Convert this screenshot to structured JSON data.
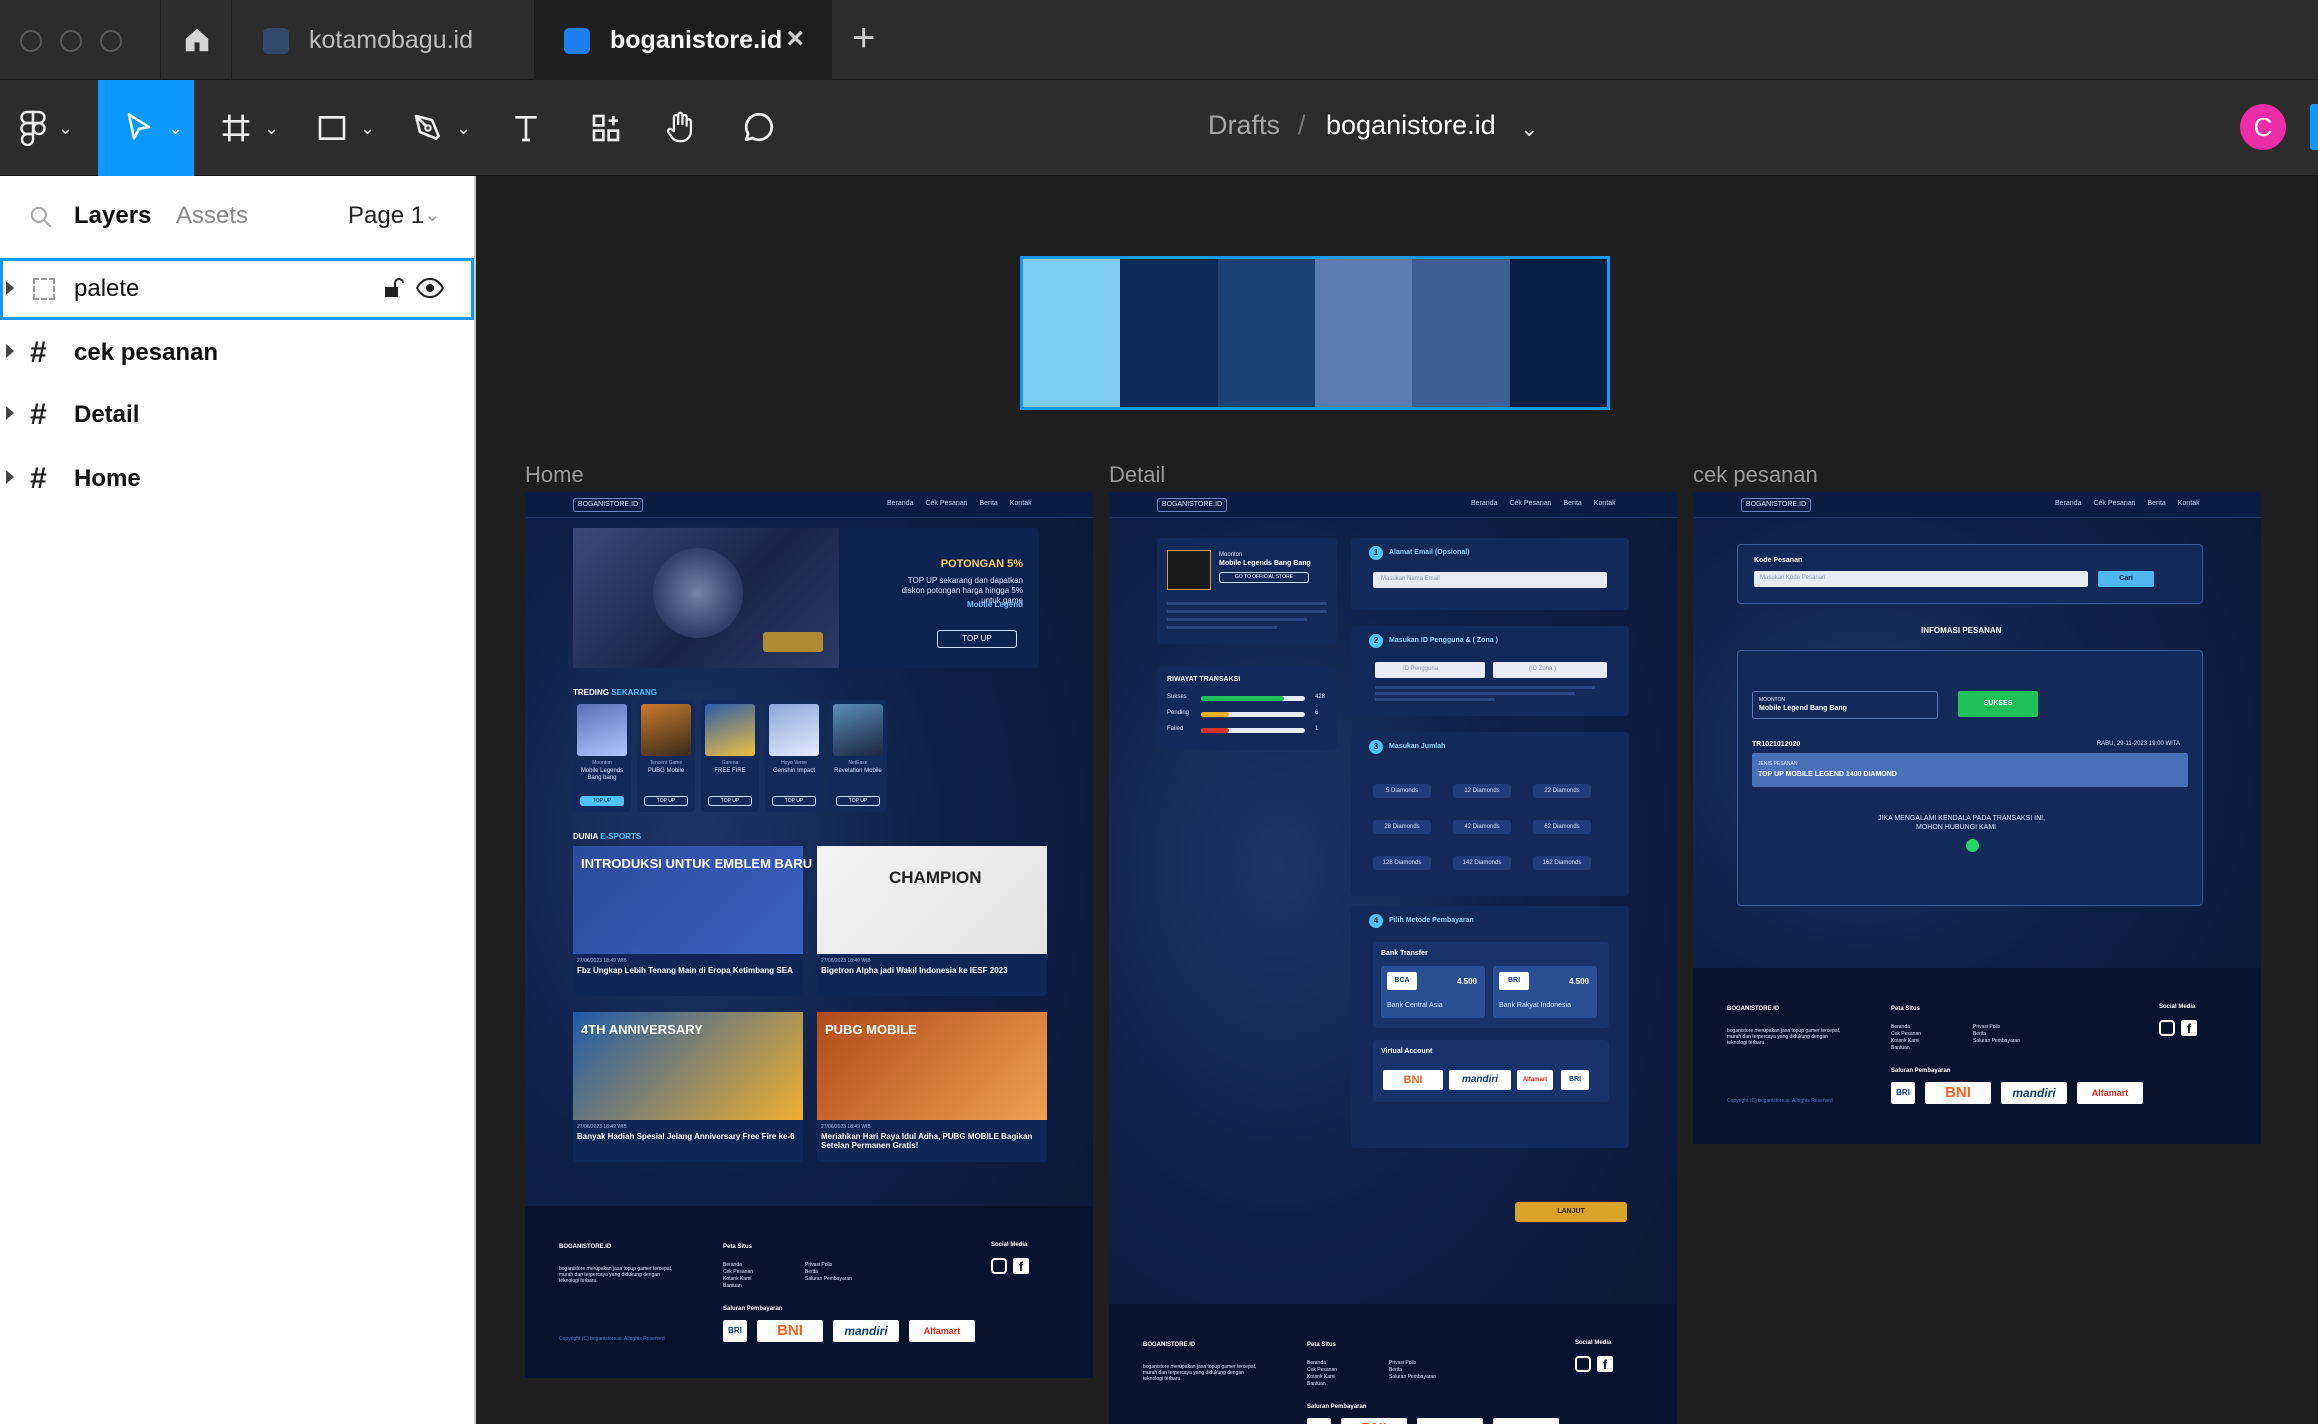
{
  "tabs": [
    {
      "label": "kotamobagu.id",
      "active": false
    },
    {
      "label": "boganistore.id",
      "active": true
    }
  ],
  "tab_close": "×",
  "new_tab": "+",
  "breadcrumb": {
    "project": "Drafts",
    "separator": "/",
    "file": "boganistore.id"
  },
  "user_initial": "C",
  "panel": {
    "tabs": [
      "Layers",
      "Assets"
    ],
    "page": "Page 1",
    "layers": [
      {
        "name": "palete",
        "type": "section",
        "selected": true
      },
      {
        "name": "cek pesanan",
        "type": "frame"
      },
      {
        "name": "Detail",
        "type": "frame"
      },
      {
        "name": "Home",
        "type": "frame"
      }
    ]
  },
  "palette": [
    "#7fcdf1",
    "#0c2a57",
    "#1d4275",
    "#5b7cb1",
    "#3d5f94",
    "#0a1f44"
  ],
  "colors": {
    "accent": "#0d99ff",
    "avatar": "#ed2ca8"
  },
  "frames": {
    "home": {
      "label": "Home",
      "logo": "BOGANISTORE.ID",
      "nav": [
        "Beranda",
        "Cek Pesanan",
        "Berita",
        "Kontak"
      ],
      "promo_title": "POTONGAN 5%",
      "promo_text": "TOP UP sekarang dan dapatkan diskon potongan harga hingga 5% untuk game",
      "promo_game": "Mobile Legend",
      "promo_button": "TOP UP",
      "trending_title": "TREDING",
      "trending_highlight": "SEKARANG",
      "games": [
        {
          "publisher": "Moonton",
          "name": "Mobile Legends Bang bang",
          "button": "TOP UP"
        },
        {
          "publisher": "Tencent Game",
          "name": "PUBG Mobile",
          "button": "TOP UP"
        },
        {
          "publisher": "Garena",
          "name": "FREE FIRE",
          "button": "TOP UP"
        },
        {
          "publisher": "Hoyo Verse",
          "name": "Genshin Impact",
          "button": "TOP UP"
        },
        {
          "publisher": "NetEase",
          "name": "Revelation Mobile",
          "button": "TOP UP"
        }
      ],
      "esports_title": "DUNIA",
      "esports_highlight": "E-SPORTS",
      "news": [
        {
          "banner": "INTRODUKSI UNTUK EMBLEM BARU",
          "date": "27/06/2023 18:49 WIB",
          "title": "Fbz Ungkap Lebih Tenang Main di Eropa Ketimbang SEA"
        },
        {
          "banner": "CHAMPION",
          "date": "27/06/2023 18:49 WIB",
          "title": "Bigetron Alpha jadi Wakil Indonesia ke IESF 2023"
        },
        {
          "banner": "4TH ANNIVERSARY",
          "date": "27/06/2023 18:49 WIB",
          "title": "Banyak Hadiah Spesial Jelang Anniversary Free Fire ke-6"
        },
        {
          "banner": "PUBG MOBILE",
          "date": "27/06/2023 18:49 WIB",
          "title": "Meriahkan Hari Raya Idul Adha, PUBG MOBILE Bagikan Setelan Permanen Gratis!"
        }
      ]
    },
    "detail": {
      "label": "Detail",
      "game_publisher": "Moonton",
      "game_name": "Mobile Legends Bang Bang",
      "official_badge": "GO TO OFFICIAL STORE",
      "history_title": "RIWAYAT TRANSAKSI",
      "history": [
        {
          "label": "Sukses",
          "value": 428
        },
        {
          "label": "Pending",
          "value": 6
        },
        {
          "label": "Failed",
          "value": 1
        }
      ],
      "step1": {
        "num": "1",
        "title": "Alamat Email (Opsional)",
        "placeholder": "Masukan Nama Email"
      },
      "step2": {
        "num": "2",
        "title": "Masukan ID Pengguna & ( Zona )",
        "id_placeholder": "ID Pengguna",
        "zone_placeholder": "(ID Zona )"
      },
      "step3": {
        "num": "3",
        "title": "Masukan Jumlah",
        "options": [
          "5 Diamonds",
          "12 Diamonds",
          "22 Diamonds",
          "28 Diamonds",
          "42 Diamonds",
          "62 Diamonds",
          "128 Diamonds",
          "142 Diamonds",
          "162 Diamonds"
        ]
      },
      "step4": {
        "num": "4",
        "title": "Pilih Metode Pembayaran",
        "bank_title": "Bank Transfer",
        "banks": [
          {
            "logo": "BCA",
            "price": "4.500",
            "name": "Bank Central Asia"
          },
          {
            "logo": "BRI",
            "price": "4.500",
            "name": "Bank Rakyat  Indonesia"
          }
        ],
        "va_title": "Virtual Account"
      },
      "submit": "LANJUT"
    },
    "cek": {
      "label": "cek pesanan",
      "code_label": "Kode Pesanan",
      "code_placeholder": "Masukan Kode Pesanan",
      "search_button": "Cari",
      "info_title": "INFOMASI PESANAN",
      "game_publisher": "MOONTON",
      "game_name": "Mobile Legend Bang Bang",
      "status": "SUKSES",
      "order_id": "TR1021012020",
      "order_date": "RABU, 29-11-2023 19:00 WITA",
      "item_label": "JENIS PESANAN",
      "item_value": "TOP UP MOBILE LEGEND 1400 DIAMOND",
      "help_line1": "JIKA MENGALAMI KENDALA PADA TRANSAKSI INI,",
      "help_line2": "MOHON HUBUNGI KAMI"
    }
  },
  "footer": {
    "brand": "BOGANISTORE.ID",
    "about": "boganistore merupakan jasa topup gamer tercepat, murah dan terpercaya yang didukung dengan teknologi terbaru.",
    "sitemap_title": "Peta Situs",
    "sitemap_col1": [
      "Beranda",
      "Cek Pesanan",
      "Kotank Kami",
      "Bantuan"
    ],
    "sitemap_col2": [
      "Privasi Polis",
      "Berita",
      "Saluran Pembayaran"
    ],
    "social_title": "Social Media",
    "payment_title": "Saluran Pembayaran",
    "payments": [
      "BRI",
      "BNI",
      "mandiri",
      "Alfamart"
    ],
    "copyright": "Copyright (C) boganistore.id. Allrights Reserved"
  }
}
